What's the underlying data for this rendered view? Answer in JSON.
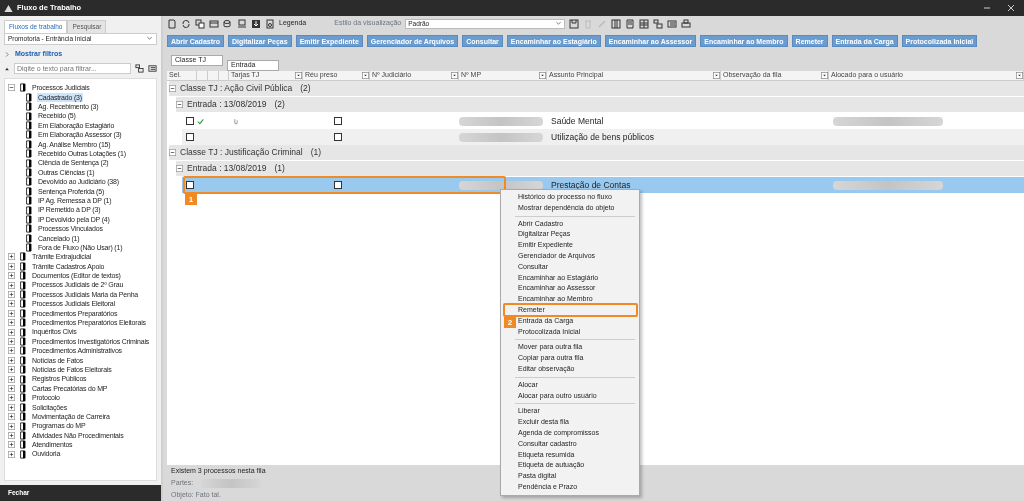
{
  "window": {
    "title": "Fluxo de Trabalho"
  },
  "sidebar": {
    "tabs": [
      {
        "label": "Fluxos de trabalho",
        "selected": true
      },
      {
        "label": "Pesquisar",
        "selected": false
      }
    ],
    "workflow_select": {
      "value": "Promotoria - Entrância Inicial"
    },
    "filters_link": "Mostrar filtros",
    "filter": {
      "placeholder": "Digite o texto para filtrar..."
    },
    "tree": [
      {
        "label": "Processos Judiciais",
        "expanded": true,
        "selected": false,
        "children": [
          {
            "label": "Cadastrado (3)",
            "selected": true
          },
          {
            "label": "Ag. Recebimento (3)",
            "selected": false
          },
          {
            "label": "Recebido (5)",
            "selected": false
          },
          {
            "label": "Em Elaboração Estagiário",
            "selected": false
          },
          {
            "label": "Em Elaboração Assessor (3)",
            "selected": false
          },
          {
            "label": "Ag. Análise Membro (15)",
            "selected": false
          },
          {
            "label": "Recebido Outras Lotações (1)",
            "selected": false
          },
          {
            "label": "Ciência de Sentença (2)",
            "selected": false
          },
          {
            "label": "Outras Ciências (1)",
            "selected": false
          },
          {
            "label": "Devolvido ao Judiciário (38)",
            "selected": false
          },
          {
            "label": "Sentença Proferida (5)",
            "selected": false
          },
          {
            "label": "IP Ag. Remessa à DP (1)",
            "selected": false
          },
          {
            "label": "IP Remetido à DP (3)",
            "selected": false
          },
          {
            "label": "IP Devolvido pela DP (4)",
            "selected": false
          },
          {
            "label": "Processos Vinculados",
            "selected": false
          },
          {
            "label": "Cancelado (1)",
            "selected": false
          },
          {
            "label": "Fora de Fluxo (Não Usar) (1)",
            "selected": false
          }
        ]
      },
      {
        "label": "Trâmite Extrajudicial",
        "expanded": false,
        "selected": false
      },
      {
        "label": "Trâmite Cadastros Apoio",
        "expanded": false,
        "selected": false
      },
      {
        "label": "Documentos (Editor de textos)",
        "expanded": false,
        "selected": false
      },
      {
        "label": "Processos Judiciais de 2º Grau",
        "expanded": false,
        "selected": false
      },
      {
        "label": "Processos Judiciais Maria da Penha",
        "expanded": false,
        "selected": false
      },
      {
        "label": "Processos Judiciais Eleitoral",
        "expanded": false,
        "selected": false
      },
      {
        "label": "Procedimentos Preparatórios",
        "expanded": false,
        "selected": false
      },
      {
        "label": "Procedimentos Preparatórios Eleitorais",
        "expanded": false,
        "selected": false
      },
      {
        "label": "Inquéritos Civis",
        "expanded": false,
        "selected": false
      },
      {
        "label": "Procedimentos Investigatórios Criminais",
        "expanded": false,
        "selected": false
      },
      {
        "label": "Procedimentos Administrativos",
        "expanded": false,
        "selected": false
      },
      {
        "label": "Notícias de Fatos",
        "expanded": false,
        "selected": false
      },
      {
        "label": "Notícias de Fatos Eleitorais",
        "expanded": false,
        "selected": false
      },
      {
        "label": "Registros Públicos",
        "expanded": false,
        "selected": false
      },
      {
        "label": "Cartas Precatórias do MP",
        "expanded": false,
        "selected": false
      },
      {
        "label": "Protocolo",
        "expanded": false,
        "selected": false
      },
      {
        "label": "Solicitações",
        "expanded": false,
        "selected": false
      },
      {
        "label": "Movimentação de Carreira",
        "expanded": false,
        "selected": false
      },
      {
        "label": "Programas do MP",
        "expanded": false,
        "selected": false
      },
      {
        "label": "Atividades Não Procedimentais",
        "expanded": false,
        "selected": false
      },
      {
        "label": "Atendimentos",
        "expanded": false,
        "selected": false
      },
      {
        "label": "Ouvidoria",
        "expanded": false,
        "selected": false
      }
    ],
    "close_button": "Fechar"
  },
  "toolbar": {
    "legend": "Legenda",
    "view_style_label": "Estilo da visualização",
    "view_style": {
      "value": "Padrão"
    }
  },
  "action_buttons": [
    "Abrir Cadastro",
    "Digitalizar Peças",
    "Emitir Expediente",
    "Gerenciador de Arquivos",
    "Consultar",
    "Encaminhar ao Estagiário",
    "Encaminhar ao Assessor",
    "Encaminhar ao Membro",
    "Remeter",
    "Entrada da Carga",
    "Protocolizada Inicial"
  ],
  "group_by": [
    "Classe TJ",
    "Entrada"
  ],
  "table": {
    "columns": [
      "Sel.",
      "",
      "",
      "",
      "Tarjas TJ",
      "Réu preso",
      "Nº Judiciário",
      "Nº MP",
      "Assunto Principal",
      "Observação da fila",
      "Alocado para o usuário"
    ],
    "groups": [
      {
        "label": "Classe TJ : Ação Civil Pública",
        "count": "(2)",
        "expanded": true,
        "subgroups": [
          {
            "label": "Entrada : 13/08/2019",
            "count": "(2)",
            "expanded": true,
            "rows": [
              {
                "selected": false,
                "checked": false,
                "done": true,
                "attachment": true,
                "reu_preso": false,
                "mp_redacted": true,
                "subject": "Saúde Mental",
                "user_redacted": true
              },
              {
                "selected": false,
                "checked": false,
                "done": false,
                "attachment": false,
                "reu_preso": false,
                "mp_redacted": true,
                "subject": "Utilização de bens públicos",
                "user_redacted": false
              }
            ]
          }
        ]
      },
      {
        "label": "Classe TJ : Justificação Criminal",
        "count": "(1)",
        "expanded": true,
        "subgroups": [
          {
            "label": "Entrada : 13/08/2019",
            "count": "(1)",
            "expanded": true,
            "rows": [
              {
                "selected": true,
                "checked": false,
                "done": false,
                "attachment": false,
                "reu_preso": false,
                "mp_redacted": true,
                "subject": "Prestação de Contas",
                "user_redacted": true,
                "callout": "1"
              }
            ]
          }
        ]
      }
    ]
  },
  "footer": {
    "summary": "Existem 3 processos nesta fila",
    "parties_label": "Partes:",
    "parties_redacted": true,
    "object": "Objeto: Fato tal."
  },
  "context_menu": {
    "sections": [
      [
        {
          "label": "Histórico do processo no fluxo"
        },
        {
          "label": "Mostrar dependência do objeto"
        }
      ],
      [
        {
          "label": "Abrir Cadastro"
        },
        {
          "label": "Digitalizar Peças"
        },
        {
          "label": "Emitir Expediente"
        },
        {
          "label": "Gerenciador de Arquivos"
        },
        {
          "label": "Consultar"
        },
        {
          "label": "Encaminhar ao Estagiário"
        },
        {
          "label": "Encaminhar ao Assessor"
        },
        {
          "label": "Encaminhar ao Membro"
        },
        {
          "label": "Remeter",
          "callout": "2"
        },
        {
          "label": "Entrada da Carga"
        },
        {
          "label": "Protocolizada Inicial"
        }
      ],
      [
        {
          "label": "Mover para outra fila"
        },
        {
          "label": "Copiar para outra fila"
        },
        {
          "label": "Editar observação"
        }
      ],
      [
        {
          "label": "Alocar"
        },
        {
          "label": "Alocar para outro usuário"
        }
      ],
      [
        {
          "label": "Liberar"
        },
        {
          "label": "Excluir desta fila"
        },
        {
          "label": "Agenda de compromissos"
        },
        {
          "label": "Consultar cadastro"
        },
        {
          "label": "Etiqueta resumida"
        },
        {
          "label": "Etiqueta de autuação"
        },
        {
          "label": "Pasta digital"
        },
        {
          "label": "Pendência e Prazo"
        }
      ]
    ]
  }
}
